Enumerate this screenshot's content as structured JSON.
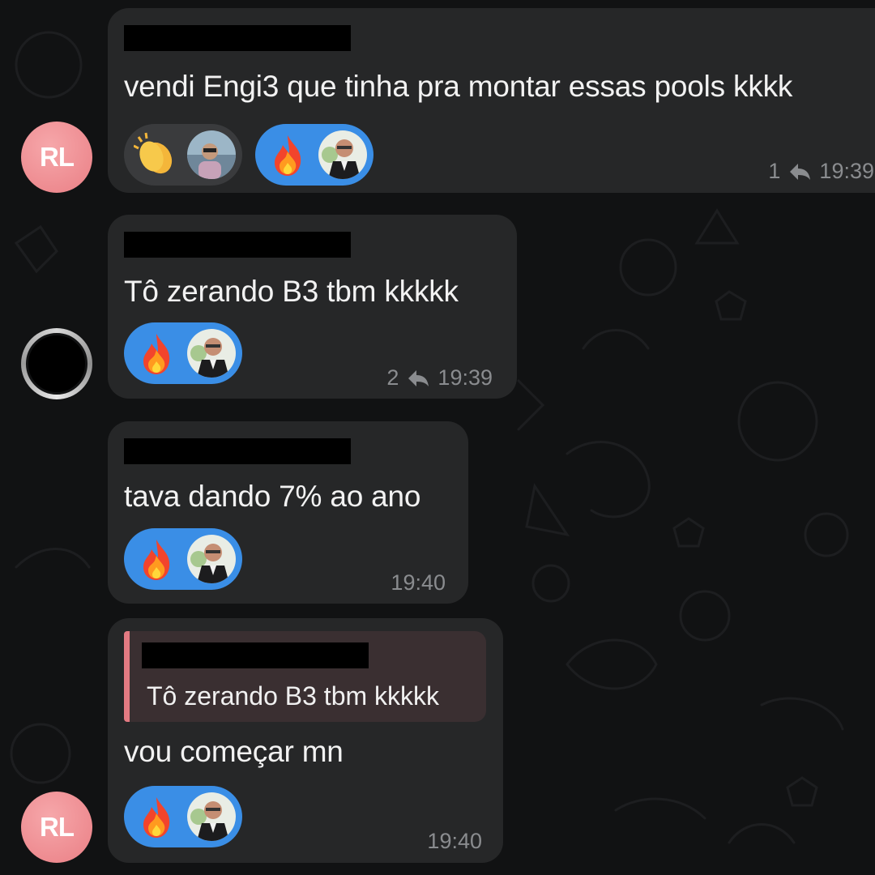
{
  "chat": {
    "messages": [
      {
        "avatar_initials": "RL",
        "text": "vendi Engi3 que tinha pra montar essas pools kkkk",
        "reply_count": "1",
        "time": "19:39",
        "reactions": [
          "clapping-hands",
          "fire"
        ]
      },
      {
        "avatar_initials": "",
        "text": "Tô zerando B3 tbm kkkkk",
        "reply_count": "2",
        "time": "19:39",
        "reactions": [
          "fire"
        ]
      },
      {
        "avatar_initials": "",
        "text": "tava dando 7% ao ano",
        "time": "19:40",
        "reactions": [
          "fire"
        ]
      },
      {
        "avatar_initials": "RL",
        "quote_text": "Tô zerando B3 tbm kkkkk",
        "text": "vou começar mn",
        "time": "19:40",
        "reactions": [
          "fire"
        ]
      }
    ]
  },
  "colors": {
    "background": "#111213",
    "bubble": "#262728",
    "own_reaction": "#3a8ee6",
    "avatar_rl": "#ec868c",
    "quote_bar": "#e37a82"
  }
}
